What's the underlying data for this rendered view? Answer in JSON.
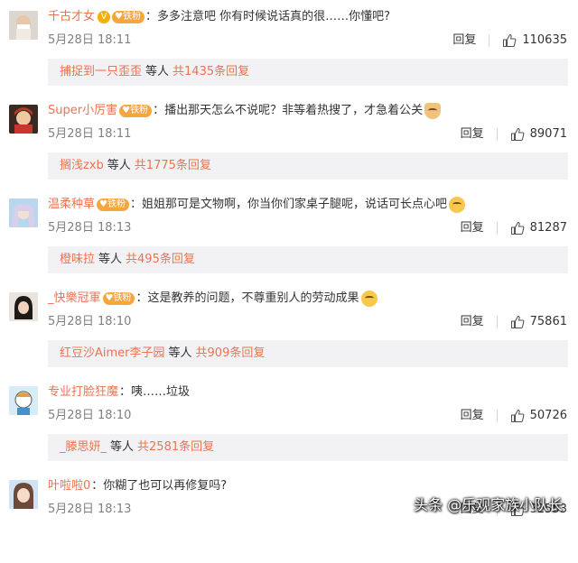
{
  "comments": [
    {
      "username": "千古才女",
      "vip_badge": "V",
      "fan_badge": "铁粉",
      "colon": "：",
      "text": "多多注意吧 你有时候说话真的很……你懂吧?",
      "date": "5月28日",
      "time": "18:11",
      "reply_label": "回复",
      "likes": "110635",
      "sub": {
        "user": "捕捉到一只歪歪",
        "etc": "等人",
        "total": "共1435条回复"
      }
    },
    {
      "username": "Super小厉害",
      "fan_badge": "铁粉",
      "colon": "：",
      "text": "播出那天怎么不说呢？非等着热搜了，才急着公关",
      "emoji": "hands-emoji",
      "date": "5月28日",
      "time": "18:11",
      "reply_label": "回复",
      "likes": "89071",
      "sub": {
        "user": "搁浅zxb",
        "etc": "等人",
        "total": "共1775条回复"
      }
    },
    {
      "username": "温柔种草",
      "fan_badge": "铁粉",
      "colon": "：",
      "text": "姐姐那可是文物啊，你当你们家桌子腿呢，说话可长点心吧",
      "emoji": "smile-emoji",
      "date": "5月28日",
      "time": "18:13",
      "reply_label": "回复",
      "likes": "81287",
      "sub": {
        "user": "橙味拉",
        "etc": "等人",
        "total": "共495条回复"
      }
    },
    {
      "username": "_快樂冠軍",
      "fan_badge": "铁粉",
      "colon": "：",
      "text": "这是教养的问题，不尊重别人的劳动成果",
      "emoji": "smirk-emoji",
      "date": "5月28日",
      "time": "18:10",
      "reply_label": "回复",
      "likes": "75861",
      "sub": {
        "user": "红豆沙Aimer李子园",
        "etc": "等人",
        "total": "共909条回复"
      }
    },
    {
      "username": "专业打脸狂魔",
      "colon": "：",
      "text": "咦……垃圾",
      "date": "5月28日",
      "time": "18:10",
      "reply_label": "回复",
      "likes": "50726",
      "sub": {
        "user": "_滕思妍_",
        "etc": "等人",
        "total": "共2581条回复"
      }
    },
    {
      "username": "叶啦啦0",
      "colon": "：",
      "text": "你糊了也可以再修复吗?",
      "date": "5月28日",
      "time": "18:13",
      "reply_label": "回复",
      "likes": "32553"
    }
  ],
  "watermark": "头条 @乐观家族小队长",
  "colors": {
    "username": "#eb7350",
    "subreply_bg": "#f2f2f5",
    "meta_text": "#808080"
  }
}
